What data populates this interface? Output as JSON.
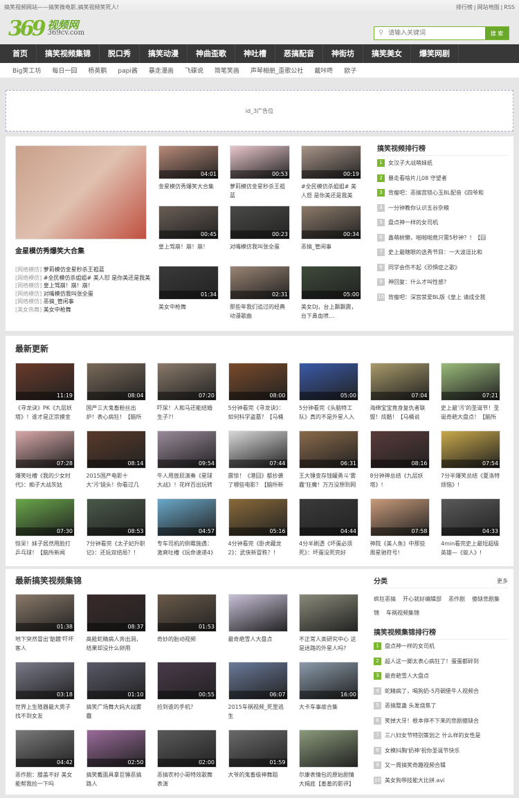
{
  "topbar": {
    "slogan": "搞笑视频网站——搞笑微电影,搞笑视频笑死人!",
    "links": [
      "排行榜",
      "|",
      "网站地图",
      "|",
      "RSS"
    ]
  },
  "logo": {
    "mark": "369",
    "cn": "视频网",
    "en": "369cv.com"
  },
  "search": {
    "placeholder": "请输入关键词",
    "button": "搜 索"
  },
  "nav": [
    "首页",
    "搞笑视频集锦",
    "脱口秀",
    "搞笑动漫",
    "神曲歪歌",
    "神吐槽",
    "恶搞配音",
    "神街坊",
    "搞笑美女",
    "爆笑网剧"
  ],
  "subnav": [
    "Big笑工坊",
    "每日一囧",
    "杨英鹏",
    "papi酱",
    "暴走漫画",
    "飞碟说",
    "简笔笑画",
    "声琴相册_歪歌公社",
    "戴咔咚",
    "欧子"
  ],
  "ad": "id_3广告位",
  "featured": {
    "title": "金星模仿秀爆笑大合集",
    "color": "#c9a08a",
    "list": [
      {
        "tag": "[网络模仿]",
        "text": "萝莉模仿金星秒杀王祖蓝"
      },
      {
        "tag": "[网络模仿]",
        "text": "#全民模仿杀姐姐# 美人怼 是你美还是我美"
      },
      {
        "tag": "[网络模仿]",
        "text": "皇上驾崩！崩！崩！"
      },
      {
        "tag": "[网络模仿]",
        "text": "对嘴模仿我叫张全蛋"
      },
      {
        "tag": "[网络模仿]",
        "text": "恶搞_管闲事"
      },
      {
        "tag": "[美女热舞]",
        "text": "美女中枪舞"
      }
    ],
    "grid": [
      {
        "title": "金星模仿秀爆笑大合集",
        "dur": "04:01",
        "color": "#b88a78"
      },
      {
        "title": "萝莉模仿金星秒杀王祖蓝",
        "dur": "00:53",
        "color": "#e8c6cc"
      },
      {
        "title": "#全民模仿杀姐姐# 美人怒 是你美还是我美",
        "dur": "00:19",
        "color": "#a89488"
      },
      {
        "title": "皇上驾崩！崩！崩！",
        "dur": "00:45",
        "color": "#6a5e56"
      },
      {
        "title": "对嘴模仿我叫张全蛋",
        "dur": "00:23",
        "color": "#4a4a48"
      },
      {
        "title": "恶搞_管闲事",
        "dur": "00:34",
        "color": "#8c7a6a"
      },
      {
        "title": "美女中枪舞",
        "dur": "01:34",
        "color": "#3a3a3a"
      },
      {
        "title": "那些年我们追过的经典动漫歌曲",
        "dur": "02:31",
        "color": "#9a8474"
      },
      {
        "title": "美女DJ，台上飘飘震，台下鼻血喷...",
        "dur": "05:00",
        "color": "#3e4a3a"
      }
    ]
  },
  "rank1": {
    "title": "搞笑视频排行榜",
    "items": [
      "女汉子大战萌妹纸",
      "暴走看啥片儿08 守望者",
      "背瘦吧：恶搞宫锁心玉BL配音《四爷和",
      "一分钟教你认识五谷杂粮",
      "盘点神一样的女司机",
      "鑫萌树懒，啪啪啪竟只需5秒钟？！【囧",
      "史上最瞎眼的选秀节目：一大波逗比和",
      "同学会伤不起《恐惧症之歌》",
      "神回复：什么才叫性感?",
      "背瘦吧：深宫禁爱BL版《皇上 请成全我"
    ]
  },
  "latest": {
    "title": "最新更新",
    "items": [
      {
        "title": "《寻龙诀》PK《九层妖塔》！谁才是正宗摸金",
        "dur": "11:19",
        "color": "#6a3a2a"
      },
      {
        "title": "国产三大鬼畜粉丝出炉！表心病狂！【脑所",
        "dur": "08:04",
        "color": "#7a6a5a"
      },
      {
        "title": "吓尿！人和马还能结婚生子?！",
        "dur": "07:20",
        "color": "#8a7a6a"
      },
      {
        "title": "5分钟看完《寻龙诀》：如何科学盗墓？【马桶说",
        "dur": "08:00",
        "color": "#7a4a2a"
      },
      {
        "title": "5分钟看完《头脑特工队》真的不是外星人入",
        "dur": "05:00",
        "color": "#3a5aa8"
      },
      {
        "title": "海绵宝宝竟身复仇者联盟！炫酷！【马桶说",
        "dur": "07:04",
        "color": "#a89a6a"
      },
      {
        "title": "史上最'污'的圣诞节！圣诞奇葩大盘点！【脑所",
        "dur": "07:21",
        "color": "#9aba7a"
      },
      {
        "title": "爆笑吐槽《我的少女时代》：痴子大战灰姑",
        "dur": "07:28",
        "color": "#d8a8a8"
      },
      {
        "title": "2015国产电影十大'污'镜头！你看过几",
        "dur": "08:14",
        "color": "#5a3a2a"
      },
      {
        "title": "牛人用放屁演奏《星球大战》！花样百出玩转",
        "dur": "09:54",
        "color": "#9a8a9a"
      },
      {
        "title": "震惊！《港囧》都抄袭了哪些电影？【脑所新",
        "dur": "07:44",
        "color": "#d8d8d8"
      },
      {
        "title": "王大锤变存钱罐勇斗'雾霾'狂魔！万万没想到网",
        "dur": "06:31",
        "color": "#8a6a4a"
      },
      {
        "title": "8分钟神总结《九层妖塔》!",
        "dur": "08:16",
        "color": "#5a3a3a"
      },
      {
        "title": "7分半爆笑总结《夏洛特烦恼》!",
        "dur": "07:54",
        "color": "#c8a84a"
      },
      {
        "title": "惊呆！妹子居然用脸打乒乓球！【脑所新闻",
        "dur": "07:30",
        "color": "#6aa84a"
      },
      {
        "title": "7分钟看完《太子妃升职记》：还玩双结局？！",
        "dur": "08:53",
        "color": "#4a5a4a"
      },
      {
        "title": "专车司机的倒霉施遇：激爽吐槽《玩命速递4》",
        "dur": "04:57",
        "color": "#6aa8c8"
      },
      {
        "title": "4分钟看完《卧虎藏龙2》：武侠新冒秩？！",
        "dur": "05:16",
        "color": "#8a6a3a"
      },
      {
        "title": "4分半刷透《坏蛋必须死》：坏蛋没死完好",
        "dur": "04:44",
        "color": "#3a3a3a"
      },
      {
        "title": "神院《美人鱼》中那些周星驰符号!",
        "dur": "07:58",
        "color": "#c89a7a"
      },
      {
        "title": "4min看完史上最短超级英雄—《蚁人》!",
        "dur": "04:33",
        "color": "#5a5a5a"
      }
    ]
  },
  "compil": {
    "title": "最新搞笑视频集锦",
    "items": [
      {
        "title": "地下突然冒出'骷髅'吓坏客人",
        "dur": "01:38",
        "color": "#8a7a6a"
      },
      {
        "title": "高能蛇精病人奔出洞，结果却没什么卵用",
        "dur": "08:37",
        "color": "#3a2a2a"
      },
      {
        "title": "奇妙的胎动视频",
        "dur": "01:53",
        "color": "#6a5a4a"
      },
      {
        "title": "最奇葩雪人大盘点",
        "dur": "",
        "color": "#c8c0d8"
      },
      {
        "title": "不正常人类研究中心 这是迷路的外星人吗?",
        "dur": "",
        "color": "#8a8a7a"
      },
      {
        "title": "世界上生殖器最大男子找不到女友",
        "dur": "03:18",
        "color": "#7a7a8a"
      },
      {
        "title": "搞笑广场舞大妈大战雾霾",
        "dur": "01:10",
        "color": "#5a5a6a"
      },
      {
        "title": "捡到谁的手机？",
        "dur": "00:55",
        "color": "#4a3a4a"
      },
      {
        "title": "2015车祸视频_死里逃生",
        "dur": "06:07",
        "color": "#6a7a9a"
      },
      {
        "title": "大卡车事故合集",
        "dur": "16:00",
        "color": "#8a9aaa"
      },
      {
        "title": "恶作剧：膝盖不好 美女能帮我捡一下吗",
        "dur": "04:42",
        "color": "#7a7a7a"
      },
      {
        "title": "搞笑戴面具拿巨锤恶搞路人",
        "dur": "02:50",
        "color": "#9a6a9a"
      },
      {
        "title": "恶搞农村小哥特效歌舞表演",
        "dur": "02:00",
        "color": "#5a5a5a"
      },
      {
        "title": "大爷的鬼畜级神舞蹈",
        "dur": "01:59",
        "color": "#6a6a6a"
      },
      {
        "title": "尔康表情包的原始剧情大揭底【羞羞的影评】",
        "dur": "",
        "color": "#8a9a7a"
      }
    ]
  },
  "categories": {
    "title": "分类",
    "more": "更多",
    "items": [
      "疯狂恶搞",
      "开心就好编辑部",
      "恶作剧",
      "傻缺悲剧集锦",
      "车祸视频集锦"
    ]
  },
  "rank2": {
    "title": "搞笑视频集锦排行榜",
    "items": [
      "盘点神一样的女司机",
      "超人这一脚太表心病狂了！蛋蛋都碎到",
      "最奇葩雪人大盘点",
      "蛇精病了，喝狗奶-5月碉堡牛人视频合",
      "恶搞整蛊 头发烧焦了",
      "笑掉大牙！根本停不下来的悲剧傻缺合",
      "三八妇女节特别策划之 什么样的女性是",
      "女模抖胸'奶神'祝你圣诞节快乐",
      "又一周搞笑奇趣视频合辑",
      "美女狗带技能大比拼.avi"
    ]
  }
}
